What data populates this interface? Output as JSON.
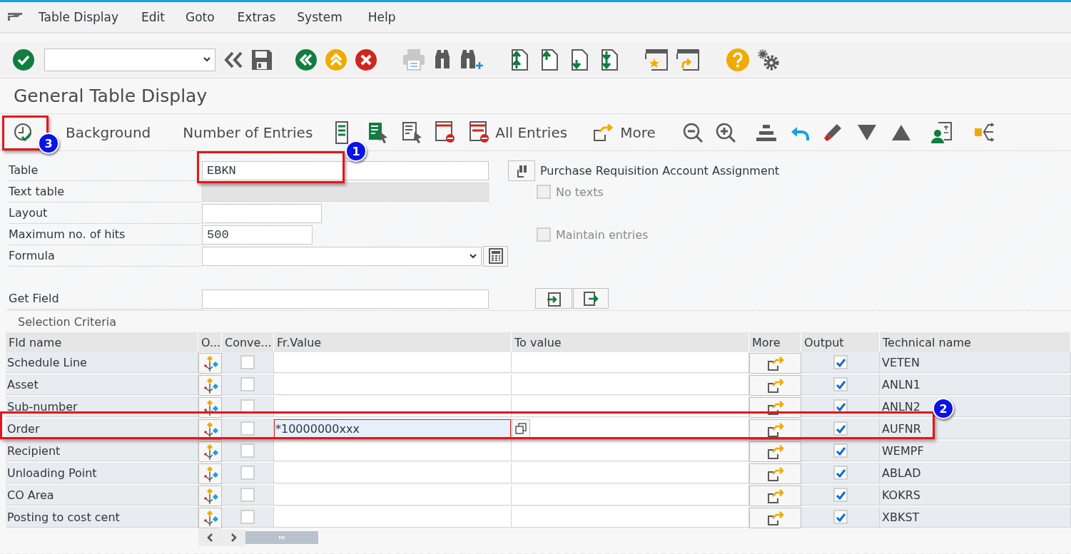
{
  "menu": [
    {
      "label": "Table Display"
    },
    {
      "label": "Edit"
    },
    {
      "label": "Goto"
    },
    {
      "label": "Extras"
    },
    {
      "label": "System"
    },
    {
      "label": "Help"
    }
  ],
  "title": "General Table Display",
  "app_toolbar": {
    "background": "Background",
    "number_of_entries": "Number of Entries",
    "all_entries": "All Entries",
    "more": "More"
  },
  "form": {
    "fields": [
      {
        "label": "Table",
        "value": "EBKN",
        "disabled": false
      },
      {
        "label": "Text table",
        "disabled": true
      },
      {
        "label": "Layout",
        "disabled": false
      },
      {
        "label": "Maximum no. of hits",
        "value": "500",
        "disabled": false
      },
      {
        "label": "Formula",
        "disabled": false
      },
      {
        "label": "Get Field",
        "disabled": false
      }
    ],
    "description": "Purchase Requisition Account Assignment",
    "options": [
      {
        "label": "No texts",
        "checked": false,
        "disabled": true
      },
      {
        "label": "Maintain entries",
        "checked": false,
        "disabled": true
      }
    ]
  },
  "selection_criteria": {
    "title": "Selection Criteria",
    "columns": [
      "Fld name",
      "O...",
      "Conve...",
      "Fr.Value",
      "To value",
      "More",
      "Output",
      "Technical name"
    ],
    "rows": [
      {
        "fld_name": "Schedule Line",
        "conversion": false,
        "fr_value": "",
        "focused": false,
        "to_value": "",
        "output": true,
        "technical_name": "VETEN"
      },
      {
        "fld_name": "Asset",
        "conversion": false,
        "fr_value": "",
        "focused": false,
        "to_value": "",
        "output": true,
        "technical_name": "ANLN1"
      },
      {
        "fld_name": "Sub-number",
        "conversion": false,
        "fr_value": "",
        "focused": false,
        "to_value": "",
        "output": true,
        "technical_name": "ANLN2"
      },
      {
        "fld_name": "Order",
        "conversion": false,
        "fr_value": "*10000000xxx",
        "focused": true,
        "to_value": "",
        "output": true,
        "technical_name": "AUFNR"
      },
      {
        "fld_name": "Recipient",
        "conversion": false,
        "fr_value": "",
        "focused": false,
        "to_value": "",
        "output": true,
        "technical_name": "WEMPF"
      },
      {
        "fld_name": "Unloading Point",
        "conversion": false,
        "fr_value": "",
        "focused": false,
        "to_value": "",
        "output": true,
        "technical_name": "ABLAD"
      },
      {
        "fld_name": "CO Area",
        "conversion": false,
        "fr_value": "",
        "focused": false,
        "to_value": "",
        "output": true,
        "technical_name": "KOKRS"
      },
      {
        "fld_name": "Posting to cost cent",
        "conversion": false,
        "fr_value": "",
        "focused": false,
        "to_value": "",
        "output": true,
        "technical_name": "XBKST"
      }
    ]
  },
  "annotations": [
    {
      "number": "1"
    },
    {
      "number": "2"
    },
    {
      "number": "3"
    }
  ]
}
